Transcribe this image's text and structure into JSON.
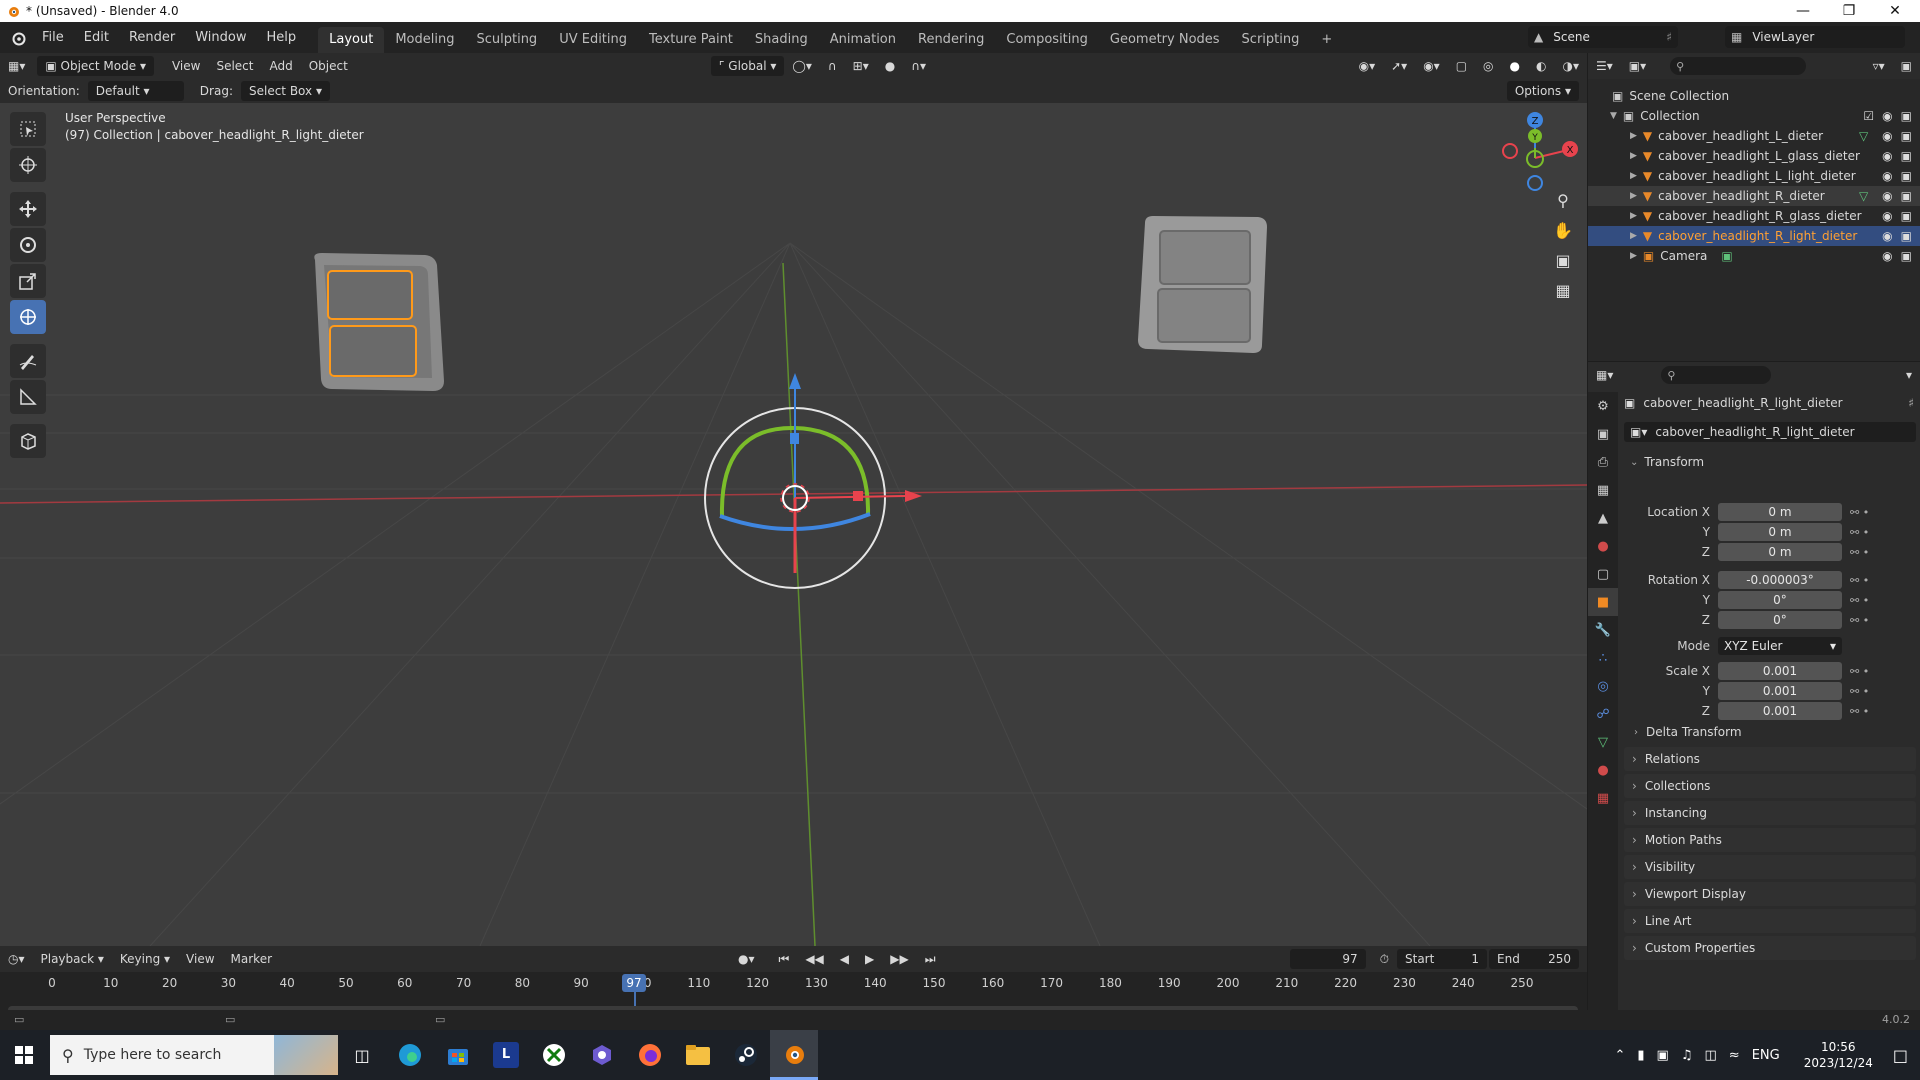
{
  "window": {
    "title": "* (Unsaved) - Blender 4.0"
  },
  "menu": [
    "File",
    "Edit",
    "Render",
    "Window",
    "Help"
  ],
  "workspaces": [
    "Layout",
    "Modeling",
    "Sculpting",
    "UV Editing",
    "Texture Paint",
    "Shading",
    "Animation",
    "Rendering",
    "Compositing",
    "Geometry Nodes",
    "Scripting"
  ],
  "active_workspace": "Layout",
  "scene": {
    "label": "Scene",
    "view_layer": "ViewLayer"
  },
  "viewport": {
    "mode": "Object Mode",
    "menus": [
      "View",
      "Select",
      "Add",
      "Object"
    ],
    "transform_orientation": "Global",
    "orientation_label": "Orientation:",
    "orientation_value": "Default",
    "drag_label": "Drag:",
    "drag_value": "Select Box",
    "options": "Options",
    "perspective": "User Perspective",
    "collection_info": "(97) Collection | cabover_headlight_R_light_dieter",
    "gizmo_axes": {
      "z": "Z",
      "y": "Y",
      "x": "X"
    }
  },
  "outliner": {
    "root": "Scene Collection",
    "collection": "Collection",
    "items": [
      {
        "name": "cabover_headlight_L_dieter",
        "state": "normal"
      },
      {
        "name": "cabover_headlight_L_glass_dieter",
        "state": "normal"
      },
      {
        "name": "cabover_headlight_L_light_dieter",
        "state": "normal"
      },
      {
        "name": "cabover_headlight_R_dieter",
        "state": "highlight"
      },
      {
        "name": "cabover_headlight_R_glass_dieter",
        "state": "normal"
      },
      {
        "name": "cabover_headlight_R_light_dieter",
        "state": "selected"
      },
      {
        "name": "Camera",
        "state": "normal"
      }
    ]
  },
  "properties": {
    "object_name": "cabover_headlight_R_light_dieter",
    "datablock": "cabover_headlight_R_light_dieter",
    "transform_title": "Transform",
    "location_label": "Location X",
    "location": {
      "x": "0 m",
      "y": "0 m",
      "z": "0 m"
    },
    "rotation_label": "Rotation X",
    "rotation": {
      "x": "-0.000003°",
      "y": "0°",
      "z": "0°"
    },
    "mode_label": "Mode",
    "mode_value": "XYZ Euler",
    "scale_label": "Scale X",
    "scale": {
      "x": "0.001",
      "y": "0.001",
      "z": "0.001"
    },
    "axis_y": "Y",
    "axis_z": "Z",
    "delta_transform": "Delta Transform",
    "panels": [
      "Relations",
      "Collections",
      "Instancing",
      "Motion Paths",
      "Visibility",
      "Viewport Display",
      "Line Art",
      "Custom Properties"
    ]
  },
  "timeline": {
    "menus": [
      "Playback",
      "Keying",
      "View",
      "Marker"
    ],
    "current_frame": "97",
    "start_label": "Start",
    "start": "1",
    "end_label": "End",
    "end": "250",
    "ticks": [
      "0",
      "10",
      "20",
      "30",
      "40",
      "50",
      "60",
      "70",
      "80",
      "90",
      "100",
      "110",
      "120",
      "130",
      "140",
      "150",
      "160",
      "170",
      "180",
      "190",
      "200",
      "210",
      "220",
      "230",
      "240",
      "250"
    ],
    "playhead_label": "97"
  },
  "status": {
    "version": "4.0.2"
  },
  "taskbar": {
    "search_placeholder": "Type here to search",
    "lang": "ENG",
    "time": "10:56",
    "date": "2023/12/24"
  },
  "colors": {
    "accent": "#4772b3",
    "selection": "#ff9a1a",
    "x_axis": "#e8434d",
    "y_axis": "#7bbd2a",
    "z_axis": "#3f86e0"
  }
}
